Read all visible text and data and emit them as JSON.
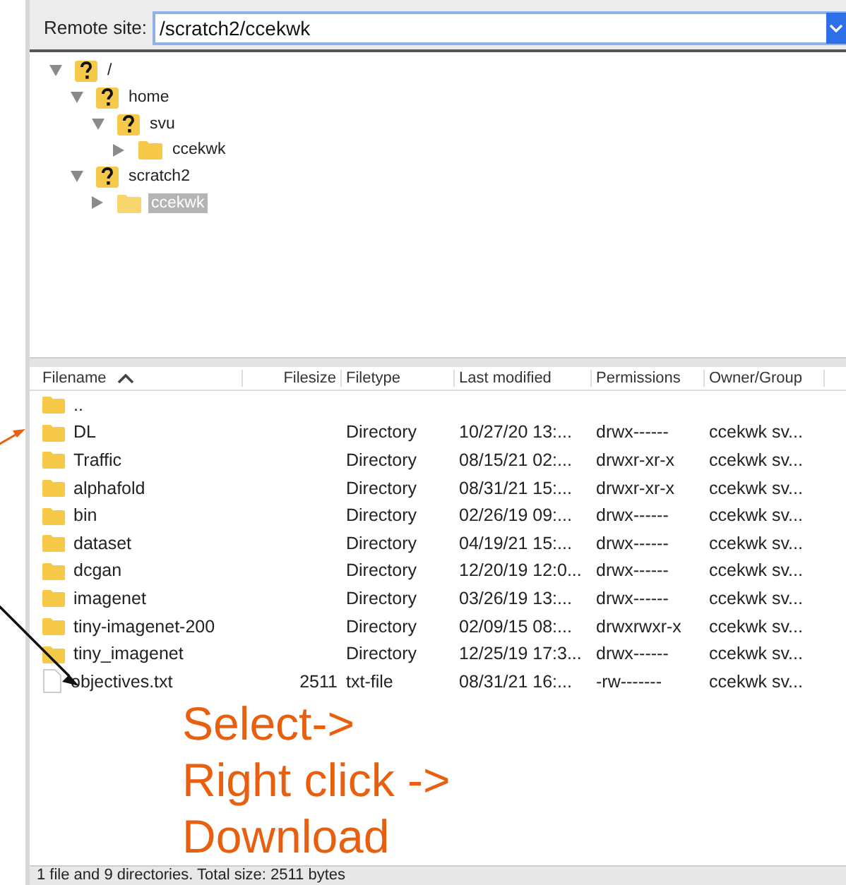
{
  "remote_site": {
    "label": "Remote site:",
    "value": "/scratch2/ccekwk"
  },
  "tree": [
    {
      "name": "/",
      "kind": "unknown",
      "expanded": true,
      "selected": false,
      "children": [
        {
          "name": "home",
          "kind": "unknown",
          "expanded": true,
          "selected": false,
          "children": [
            {
              "name": "svu",
              "kind": "unknown",
              "expanded": true,
              "selected": false,
              "children": [
                {
                  "name": "ccekwk",
                  "kind": "folder",
                  "expanded": false,
                  "selected": false
                }
              ]
            }
          ]
        },
        {
          "name": "scratch2",
          "kind": "unknown",
          "expanded": true,
          "selected": false,
          "children": [
            {
              "name": "ccekwk",
              "kind": "folder",
              "expanded": false,
              "selected": true
            }
          ]
        }
      ]
    }
  ],
  "table": {
    "columns": [
      "Filename",
      "Filesize",
      "Filetype",
      "Last modified",
      "Permissions",
      "Owner/Group"
    ],
    "rows": [
      {
        "kind": "folder",
        "cells": [
          "..",
          "",
          "",
          "",
          "",
          ""
        ]
      },
      {
        "kind": "folder",
        "cells": [
          "DL",
          "",
          "Directory",
          "10/27/20 13:...",
          "drwx------",
          "ccekwk sv..."
        ]
      },
      {
        "kind": "folder",
        "cells": [
          "Traffic",
          "",
          "Directory",
          "08/15/21 02:...",
          "drwxr-xr-x",
          "ccekwk sv..."
        ]
      },
      {
        "kind": "folder",
        "cells": [
          "alphafold",
          "",
          "Directory",
          "08/31/21 15:...",
          "drwxr-xr-x",
          "ccekwk sv..."
        ]
      },
      {
        "kind": "folder",
        "cells": [
          "bin",
          "",
          "Directory",
          "02/26/19 09:...",
          "drwx------",
          "ccekwk sv..."
        ]
      },
      {
        "kind": "folder",
        "cells": [
          "dataset",
          "",
          "Directory",
          "04/19/21 15:...",
          "drwx------",
          "ccekwk sv..."
        ]
      },
      {
        "kind": "folder",
        "cells": [
          "dcgan",
          "",
          "Directory",
          "12/20/19 12:0...",
          "drwx------",
          "ccekwk sv..."
        ]
      },
      {
        "kind": "folder",
        "cells": [
          "imagenet",
          "",
          "Directory",
          "03/26/19 13:...",
          "drwx------",
          "ccekwk sv..."
        ]
      },
      {
        "kind": "folder",
        "cells": [
          "tiny-imagenet-200",
          "",
          "Directory",
          "02/09/15 08:...",
          "drwxrwxr-x",
          "ccekwk sv..."
        ]
      },
      {
        "kind": "folder",
        "cells": [
          "tiny_imagenet",
          "",
          "Directory",
          "12/25/19 17:3...",
          "drwx------",
          "ccekwk sv..."
        ]
      },
      {
        "kind": "file",
        "cells": [
          "objectives.txt",
          "2511",
          "txt-file",
          "08/31/21 16:...",
          "-rw-------",
          "ccekwk sv..."
        ]
      }
    ]
  },
  "annotation": [
    "Select->",
    "Right click ->",
    "Download"
  ],
  "status_bar": "1 file and 9 directories. Total size: 2511 bytes"
}
